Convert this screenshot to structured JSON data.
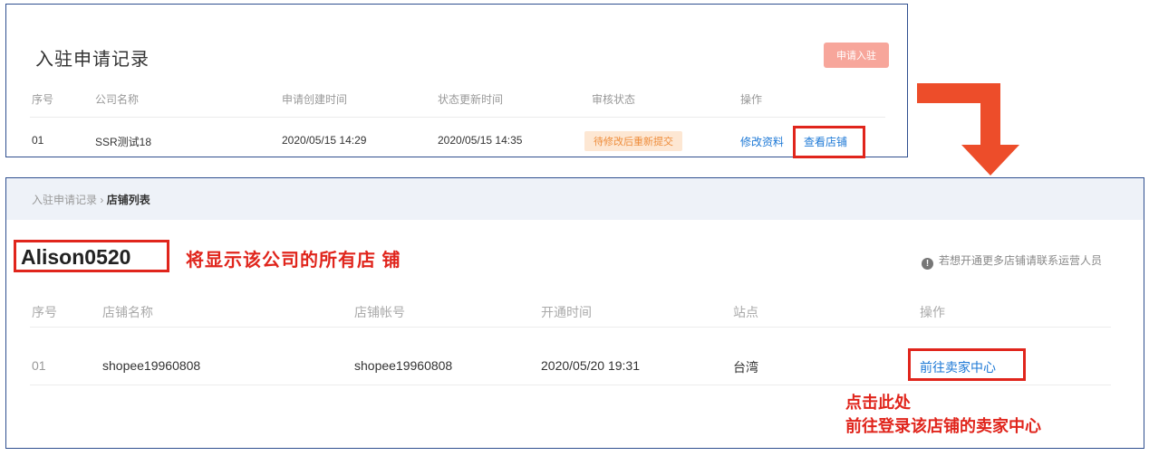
{
  "records": {
    "title": "入驻申请记录",
    "apply_button": "申请入驻",
    "headers": [
      "序号",
      "公司名称",
      "申请创建时间",
      "状态更新时间",
      "审核状态",
      "操作"
    ],
    "row": {
      "index": "01",
      "company": "SSR测试18",
      "created": "2020/05/15 14:29",
      "updated": "2020/05/15 14:35",
      "status": "待修改后重新提交",
      "action_edit": "修改资料",
      "action_view": "查看店铺"
    }
  },
  "arrow": {
    "color": "#ed4d2a"
  },
  "shops": {
    "breadcrumb": {
      "parent": "入驻申请记录",
      "separator": "›",
      "current": "店铺列表"
    },
    "company_name": "Alison0520",
    "annotation_top": "将显示该公司的所有店 铺",
    "hint": "若想开通更多店铺请联系运营人员",
    "hint_icon": "info-icon",
    "headers": [
      "序号",
      "店铺名称",
      "店铺帐号",
      "开通时间",
      "站点",
      "操作"
    ],
    "row": {
      "index": "01",
      "shop_name": "shopee19960808",
      "account": "shopee19960808",
      "opened": "2020/05/20 19:31",
      "site": "台湾",
      "action": "前往卖家中心"
    },
    "annotation_bottom_1": "点击此处",
    "annotation_bottom_2": "前往登录该店铺的卖家中心"
  },
  "colors": {
    "highlight": "#e0251c",
    "link": "#1e79d6",
    "status_badge_bg": "#fde7d3",
    "status_badge_text": "#ee8c3a",
    "apply_button_bg": "#f7a69b"
  }
}
